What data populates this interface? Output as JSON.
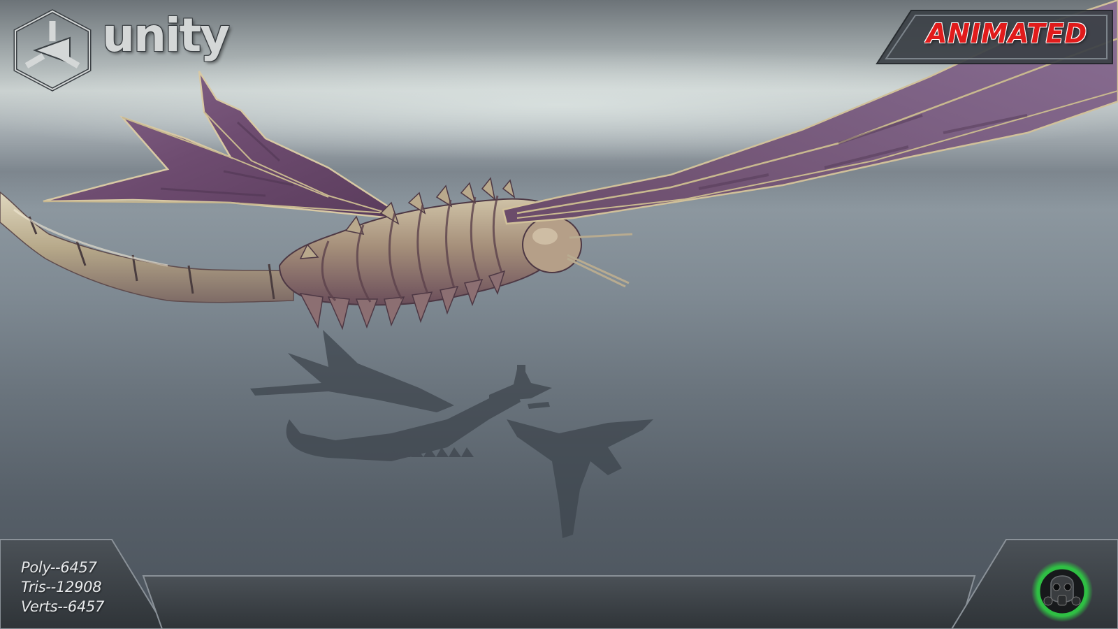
{
  "branding": {
    "engine_wordmark": "unity",
    "engine_logo_icon": "unity-cube-icon",
    "studio_logo_icon": "gas-mask-icon"
  },
  "badge": {
    "label": "ANIMATED",
    "color": "#e11b1b"
  },
  "model_stats": {
    "poly": "Poly--6457",
    "tris": "Tris--12908",
    "verts": "Verts--6457"
  },
  "colors": {
    "wing": "#6b4a6b",
    "body": "#a89a7c",
    "panel": "#3a3f44",
    "studio_glow": "#39d24a"
  }
}
